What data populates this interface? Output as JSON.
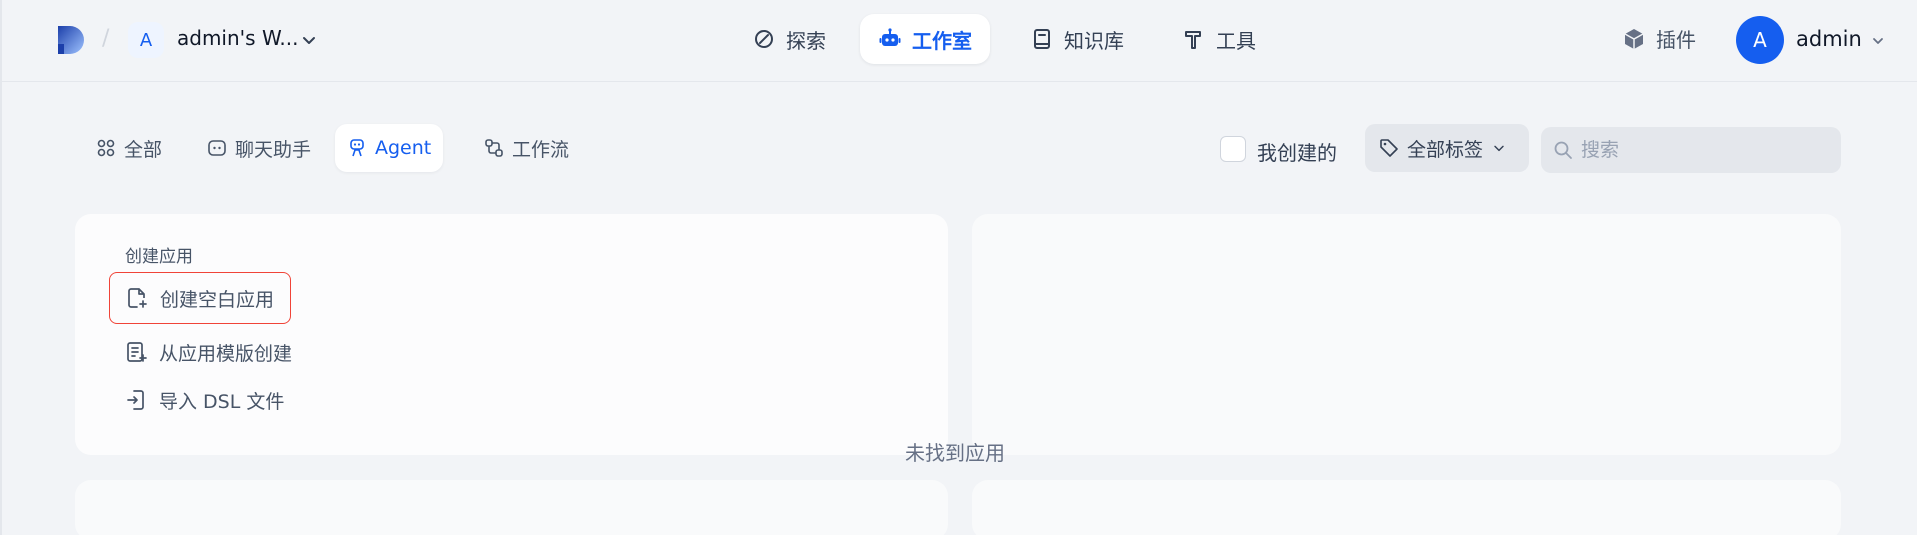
{
  "workspace": {
    "avatar_letter": "A",
    "name": "admin's W..."
  },
  "nav": [
    {
      "label": "探索",
      "icon": "compass-icon"
    },
    {
      "label": "工作室",
      "icon": "robot-icon",
      "active": true
    },
    {
      "label": "知识库",
      "icon": "book-icon"
    },
    {
      "label": "工具",
      "icon": "hammer-icon"
    }
  ],
  "header_right": {
    "plugins_label": "插件",
    "user_initial": "A",
    "user_name": "admin"
  },
  "tabs": [
    {
      "label": "全部",
      "icon": "grid-icon"
    },
    {
      "label": "聊天助手",
      "icon": "chat-icon"
    },
    {
      "label": "Agent",
      "icon": "agent-icon",
      "active": true
    },
    {
      "label": "工作流",
      "icon": "workflow-icon"
    }
  ],
  "filters": {
    "created_by_me_label": "我创建的",
    "tags_label": "全部标签",
    "search_placeholder": "搜索"
  },
  "create_section": {
    "title": "创建应用",
    "options": [
      {
        "label": "创建空白应用",
        "icon": "file-plus-icon",
        "highlighted": true
      },
      {
        "label": "从应用模版创建",
        "icon": "template-icon"
      },
      {
        "label": "导入 DSL 文件",
        "icon": "file-import-icon"
      }
    ]
  },
  "empty_state": "未找到应用",
  "colors": {
    "accent": "#155eef",
    "highlight_border": "#f04438",
    "background": "#f2f4f7"
  }
}
